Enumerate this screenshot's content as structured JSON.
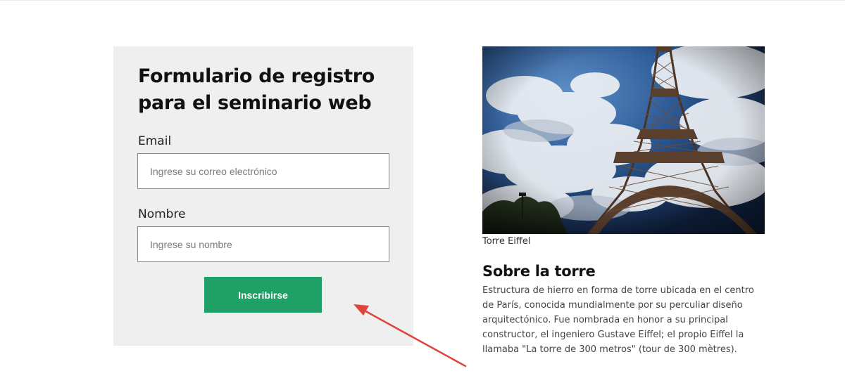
{
  "form": {
    "title": "Formulario de registro para el seminario web",
    "email_label": "Email",
    "email_placeholder": "Ingrese su correo electrónico",
    "email_value": "",
    "name_label": "Nombre",
    "name_placeholder": "Ingrese su nombre",
    "name_value": "",
    "submit_label": "Inscribirse",
    "submit_color": "#1fa067"
  },
  "photo": {
    "subject": "eiffel-tower-photo",
    "caption": "Torre Eiffel"
  },
  "about": {
    "heading": "Sobre la torre",
    "body": "Estructura de hierro en forma de torre ubicada en el centro de París, conocida mundialmente por su perculiar diseño arquitectónico. Fue nombrada en honor a su principal constructor, el ingeniero Gustave Eiffel; el propio Eiffel la llamaba \"La torre de 300 metros\" (tour de 300 mètres)."
  },
  "annotation": {
    "arrow_color": "#e0443a"
  }
}
